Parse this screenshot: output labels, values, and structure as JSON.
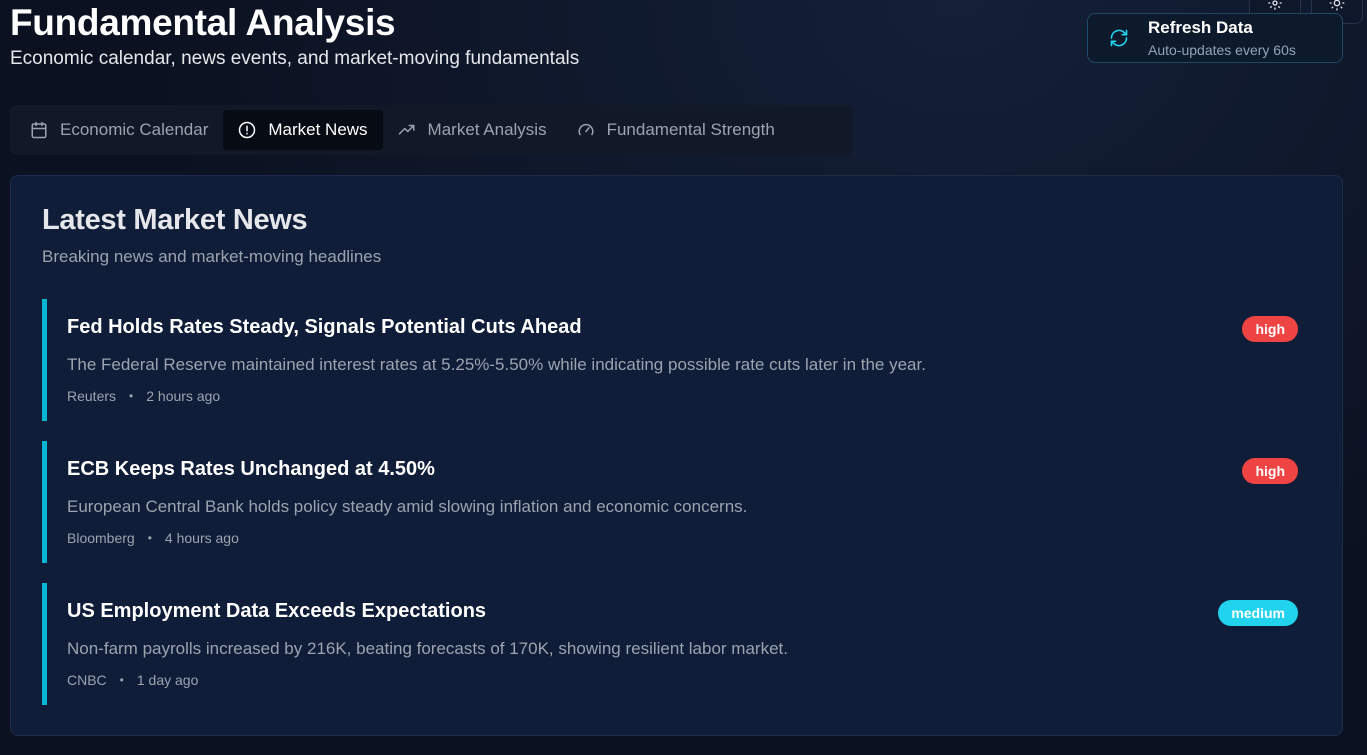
{
  "header": {
    "title": "Fundamental Analysis",
    "subtitle": "Economic calendar, news events, and market-moving fundamentals"
  },
  "toolbar": {
    "settings_icon": "gear-icon",
    "theme_icon": "sun-icon",
    "refresh": {
      "label": "Refresh Data",
      "sublabel": "Auto-updates every 60s",
      "icon": "refresh-icon"
    }
  },
  "tabs": [
    {
      "label": "Economic Calendar",
      "icon": "calendar-icon",
      "active": false
    },
    {
      "label": "Market News",
      "icon": "alert-circle-icon",
      "active": true
    },
    {
      "label": "Market Analysis",
      "icon": "trending-up-icon",
      "active": false
    },
    {
      "label": "Fundamental Strength",
      "icon": "gauge-icon",
      "active": false
    }
  ],
  "news": {
    "title": "Latest Market News",
    "subtitle": "Breaking news and market-moving headlines",
    "items": [
      {
        "headline": "Fed Holds Rates Steady, Signals Potential Cuts Ahead",
        "description": "The Federal Reserve maintained interest rates at 5.25%-5.50% while indicating possible rate cuts later in the year.",
        "source": "Reuters",
        "time": "2 hours ago",
        "impact": "high"
      },
      {
        "headline": "ECB Keeps Rates Unchanged at 4.50%",
        "description": "European Central Bank holds policy steady amid slowing inflation and economic concerns.",
        "source": "Bloomberg",
        "time": "4 hours ago",
        "impact": "high"
      },
      {
        "headline": "US Employment Data Exceeds Expectations",
        "description": "Non-farm payrolls increased by 216K, beating forecasts of 170K, showing resilient labor market.",
        "source": "CNBC",
        "time": "1 day ago",
        "impact": "medium"
      }
    ]
  },
  "colors": {
    "accent": "#06b6d4",
    "high": "#ef4444",
    "medium": "#22d3ee"
  }
}
